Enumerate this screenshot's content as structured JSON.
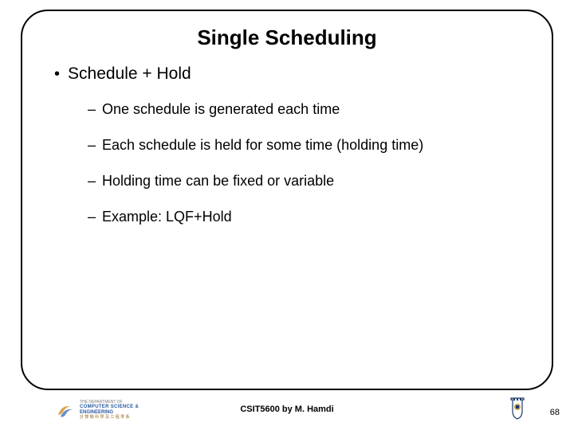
{
  "title": "Single Scheduling",
  "main_bullet": "Schedule + Hold",
  "sub_bullets": [
    "One schedule is generated each time",
    "Each schedule is held for some time (holding time)",
    "Holding time can be fixed or variable",
    "Example: LQF+Hold"
  ],
  "footer": {
    "dept_line1": "THE DEPARTMENT OF",
    "dept_line2": "COMPUTER SCIENCE &",
    "dept_line3": "ENGINEERING",
    "dept_line4": "計 算 機 科 學 及 工 程 學 系",
    "course": "CSIT5600 by M. Hamdi",
    "page_number": "68"
  }
}
